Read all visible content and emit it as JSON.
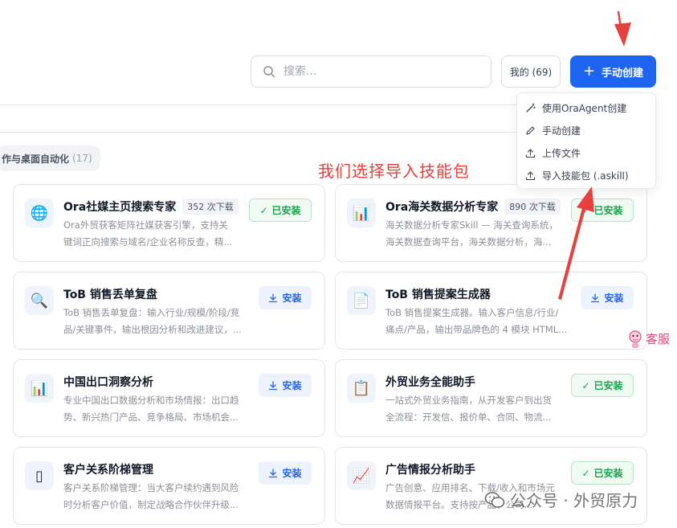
{
  "search": {
    "placeholder": "搜索..."
  },
  "header": {
    "mine_label": "我的 (69)",
    "create_label": "手动创建"
  },
  "category": {
    "name": "作与桌面自动化",
    "count": "(17)"
  },
  "dropdown": {
    "items": [
      {
        "label": "使用OraAgent创建",
        "icon": "magic-wand-icon"
      },
      {
        "label": "手动创建",
        "icon": "pencil-icon"
      },
      {
        "label": "上传文件",
        "icon": "upload-icon"
      },
      {
        "label": "导入技能包 (.askill)",
        "icon": "upload-icon"
      }
    ]
  },
  "annotation": {
    "text": "我们选择导入技能包"
  },
  "cards": [
    {
      "icon": "🌐",
      "title": "Ora社媒主页搜索专家",
      "downloads": "352 次下载",
      "desc1": "Ora外贸获客矩阵社媒获客引擎，支持关",
      "desc2": "键词正向搜索与域名/企业名称反查，精...",
      "status": "installed",
      "status_label": "已安装"
    },
    {
      "icon": "📊",
      "title": "Ora海关数据分析专家",
      "downloads": "890 次下载",
      "desc1": "海关数据分析专家Skill — 海关查询系统，",
      "desc2": "海关数据查询平台，海关数据分析，海...",
      "status": "installed",
      "status_label": "已安装"
    },
    {
      "icon": "🔍",
      "title": "ToB 销售丢单复盘",
      "downloads": "",
      "desc1": "ToB 销售丢单复盘：输入行业/规模/阶段/竞",
      "desc2": "品/关键事件，输出根因分析和改进建议，...",
      "status": "install",
      "status_label": "安装"
    },
    {
      "icon": "📄",
      "title": "ToB 销售提案生成器",
      "downloads": "",
      "desc1": "ToB 销售提案生成器。输入客户信息/行业/",
      "desc2": "痛点/产品，输出带品牌色的 4 模块 HTML...",
      "status": "install",
      "status_label": "安装"
    },
    {
      "icon": "📊",
      "title": "中国出口洞察分析",
      "downloads": "",
      "desc1": "专业中国出口数据分析和市场情报：出口趋",
      "desc2": "势、新兴热门产品、竞争格局、市场机会...",
      "status": "install",
      "status_label": "安装"
    },
    {
      "icon": "📋",
      "title": "外贸业务全能助手",
      "downloads": "",
      "desc1": "一站式外贸业务指南，从开发客户到出货",
      "desc2": "全流程：开发信、报价单、合同、物流...",
      "status": "installed",
      "status_label": "已安装"
    },
    {
      "icon": "▯",
      "title": "客户关系阶梯管理",
      "downloads": "",
      "desc1": "客户关系阶梯管理：当大客户续约遇到风险",
      "desc2": "时分析客户价值，制定战略合作伙伴升级...",
      "status": "install",
      "status_label": "安装"
    },
    {
      "icon": "📈",
      "title": "广告情报分析助手",
      "downloads": "",
      "desc1": "广告创意、应用排名、下载/收入和市场元",
      "desc2": "数据情报平台。支持按产品、公司...",
      "status": "installed",
      "status_label": "已安装"
    }
  ],
  "support": {
    "label": "客服"
  },
  "watermark": {
    "text": "公众号 · 外贸原力"
  },
  "colors": {
    "primary": "#1d64f0",
    "success": "#17a34a",
    "annotation": "#e5413f"
  }
}
